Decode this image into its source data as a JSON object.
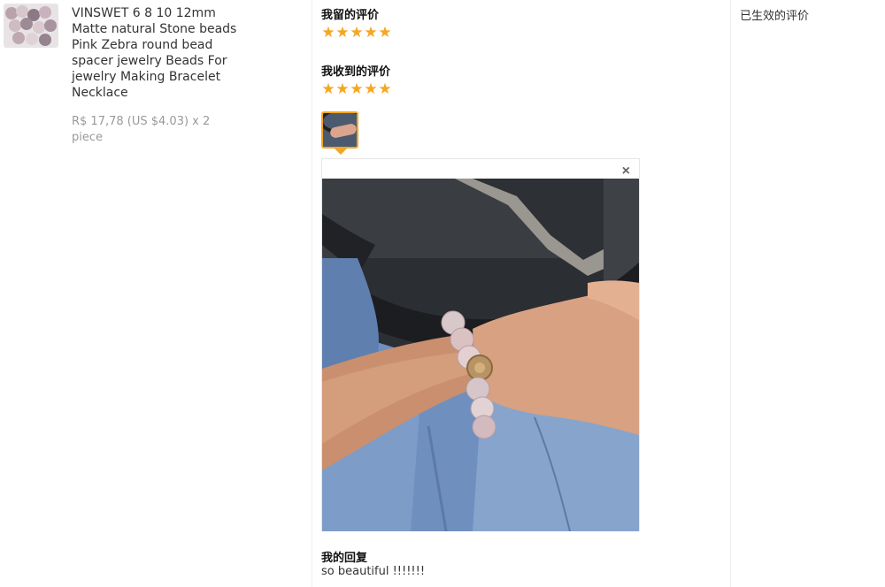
{
  "product": {
    "title": "VINSWET 6 8 10 12mm Matte natural Stone beads Pink Zebra round bead spacer jewelry Beads For jewelry Making Bracelet Necklace",
    "price": "R$ 17,78 (US $4.03) x 2 piece",
    "thumbnail_icon": "beads-photo"
  },
  "review": {
    "my_review_label": "我留的评价",
    "my_rating": 5,
    "received_review_label": "我收到的评价",
    "received_rating": 5,
    "photo_icon": "bracelet-photo",
    "close_symbol": "×",
    "reply_label": "我的回复",
    "reply_text": "so beautiful !!!!!!!"
  },
  "status": {
    "text": "已生效的评价"
  },
  "colors": {
    "star": "#f5a623",
    "divider": "#efefef",
    "price": "#999999"
  }
}
